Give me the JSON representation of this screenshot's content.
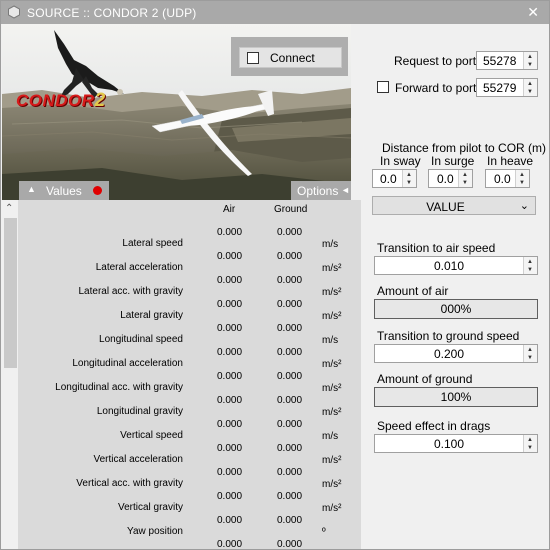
{
  "window": {
    "title": "SOURCE :: CONDOR 2 (UDP)",
    "close_glyph": "✕"
  },
  "hero": {
    "logo_text": "CONDOR",
    "logo_number": "2",
    "connect_label": "Connect",
    "connect_checked": false
  },
  "tabs": {
    "values_label": "Values",
    "values_arrow": "▲",
    "options_label": "Options",
    "options_arrow": "◄",
    "status_color": "#e00000"
  },
  "values_table": {
    "headers": [
      "Air",
      "Ground"
    ],
    "top_air": "0.000",
    "top_ground": "0.000",
    "rows": [
      {
        "label": "Lateral speed",
        "unit": "m/s",
        "air": "0.000",
        "ground": "0.000"
      },
      {
        "label": "Lateral acceleration",
        "unit": "m/s²",
        "air": "0.000",
        "ground": "0.000"
      },
      {
        "label": "Lateral acc. with gravity",
        "unit": "m/s²",
        "air": "0.000",
        "ground": "0.000"
      },
      {
        "label": "Lateral gravity",
        "unit": "m/s²",
        "air": "0.000",
        "ground": "0.000"
      },
      {
        "label": "Longitudinal speed",
        "unit": "m/s",
        "air": "0.000",
        "ground": "0.000"
      },
      {
        "label": "Longitudinal acceleration",
        "unit": "m/s²",
        "air": "0.000",
        "ground": "0.000"
      },
      {
        "label": "Longitudinal acc. with gravity",
        "unit": "m/s²",
        "air": "0.000",
        "ground": "0.000"
      },
      {
        "label": "Longitudinal gravity",
        "unit": "m/s²",
        "air": "0.000",
        "ground": "0.000"
      },
      {
        "label": "Vertical speed",
        "unit": "m/s",
        "air": "0.000",
        "ground": "0.000"
      },
      {
        "label": "Vertical acceleration",
        "unit": "m/s²",
        "air": "0.000",
        "ground": "0.000"
      },
      {
        "label": "Vertical acc. with gravity",
        "unit": "m/s²",
        "air": "0.000",
        "ground": "0.000"
      },
      {
        "label": "Vertical gravity",
        "unit": "m/s²",
        "air": "0.000",
        "ground": "0.000"
      },
      {
        "label": "Yaw position",
        "unit": "º",
        "air": "0.000",
        "ground": "0.000"
      }
    ]
  },
  "ports": {
    "request_label": "Request to port",
    "request_value": "55278",
    "forward_label": "Forward to port",
    "forward_value": "55279",
    "forward_checked": false
  },
  "cor": {
    "title": "Distance from pilot to COR (m)",
    "sway_label": "In sway",
    "surge_label": "In surge",
    "heave_label": "In heave",
    "sway_value": "0.0",
    "surge_value": "0.0",
    "heave_value": "0.0"
  },
  "mode": {
    "selected": "VALUE"
  },
  "air_ground": {
    "air_speed_label": "Transition to air speed",
    "air_speed_value": "0.010",
    "amount_air_label": "Amount of air",
    "amount_air_value": "000%",
    "ground_speed_label": "Transition to ground speed",
    "ground_speed_value": "0.200",
    "amount_ground_label": "Amount of ground",
    "amount_ground_value": "100%",
    "drag_label": "Speed effect in drags",
    "drag_value": "0.100"
  }
}
